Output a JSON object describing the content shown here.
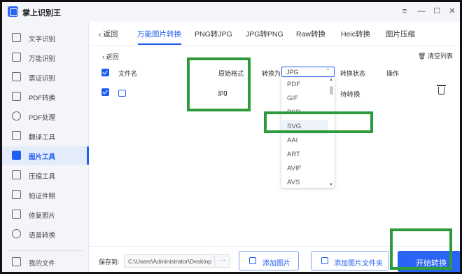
{
  "app": {
    "title": "掌上识别王"
  },
  "window_controls": {
    "menu": "≡",
    "minimize": "—",
    "maximize": "☐",
    "close": "✕"
  },
  "sidebar": {
    "items": [
      {
        "label": "文字识别",
        "icon": "text-scan-icon"
      },
      {
        "label": "万能识别",
        "icon": "universal-scan-icon"
      },
      {
        "label": "票证识别",
        "icon": "ticket-scan-icon"
      },
      {
        "label": "PDF转换",
        "icon": "pdf-convert-icon"
      },
      {
        "label": "PDF处理",
        "icon": "pdf-process-icon"
      },
      {
        "label": "翻译工具",
        "icon": "translate-icon"
      },
      {
        "label": "图片工具",
        "icon": "image-tool-icon",
        "active": true
      },
      {
        "label": "压缩工具",
        "icon": "compress-icon"
      },
      {
        "label": "拍证件照",
        "icon": "id-photo-icon"
      },
      {
        "label": "修复照片",
        "icon": "repair-photo-icon"
      },
      {
        "label": "语音转换",
        "icon": "voice-convert-icon"
      }
    ],
    "my_files": "我的文件"
  },
  "tabs": {
    "back": "返回",
    "items": [
      "万能图片转换",
      "PNG转JPG",
      "JPG转PNG",
      "Raw转换",
      "Heic转换",
      "图片压缩"
    ],
    "active_index": 0
  },
  "content": {
    "back": "返回",
    "clear_list": "清空列表",
    "headers": {
      "filename": "文件名",
      "original_format": "原始格式",
      "convert_to": "转换为",
      "status": "转换状态",
      "action": "操作"
    },
    "select_value": "JPG",
    "row": {
      "original_format": "jpg",
      "status": "待转换"
    }
  },
  "dropdown": {
    "options": [
      "PDF",
      "GIF",
      "PSD",
      "SVG",
      "AAI",
      "ART",
      "AVIF",
      "AVS"
    ],
    "highlighted": "SVG"
  },
  "bottom": {
    "save_to": "保存到:",
    "path": "C:\\Users\\Administrator\\Desktop",
    "browse": "···",
    "add_image": "添加图片",
    "add_folder": "添加图片文件夹",
    "start": "开始转换"
  },
  "colors": {
    "accent": "#1f5ef0",
    "annotation": "#2f9a3a"
  }
}
